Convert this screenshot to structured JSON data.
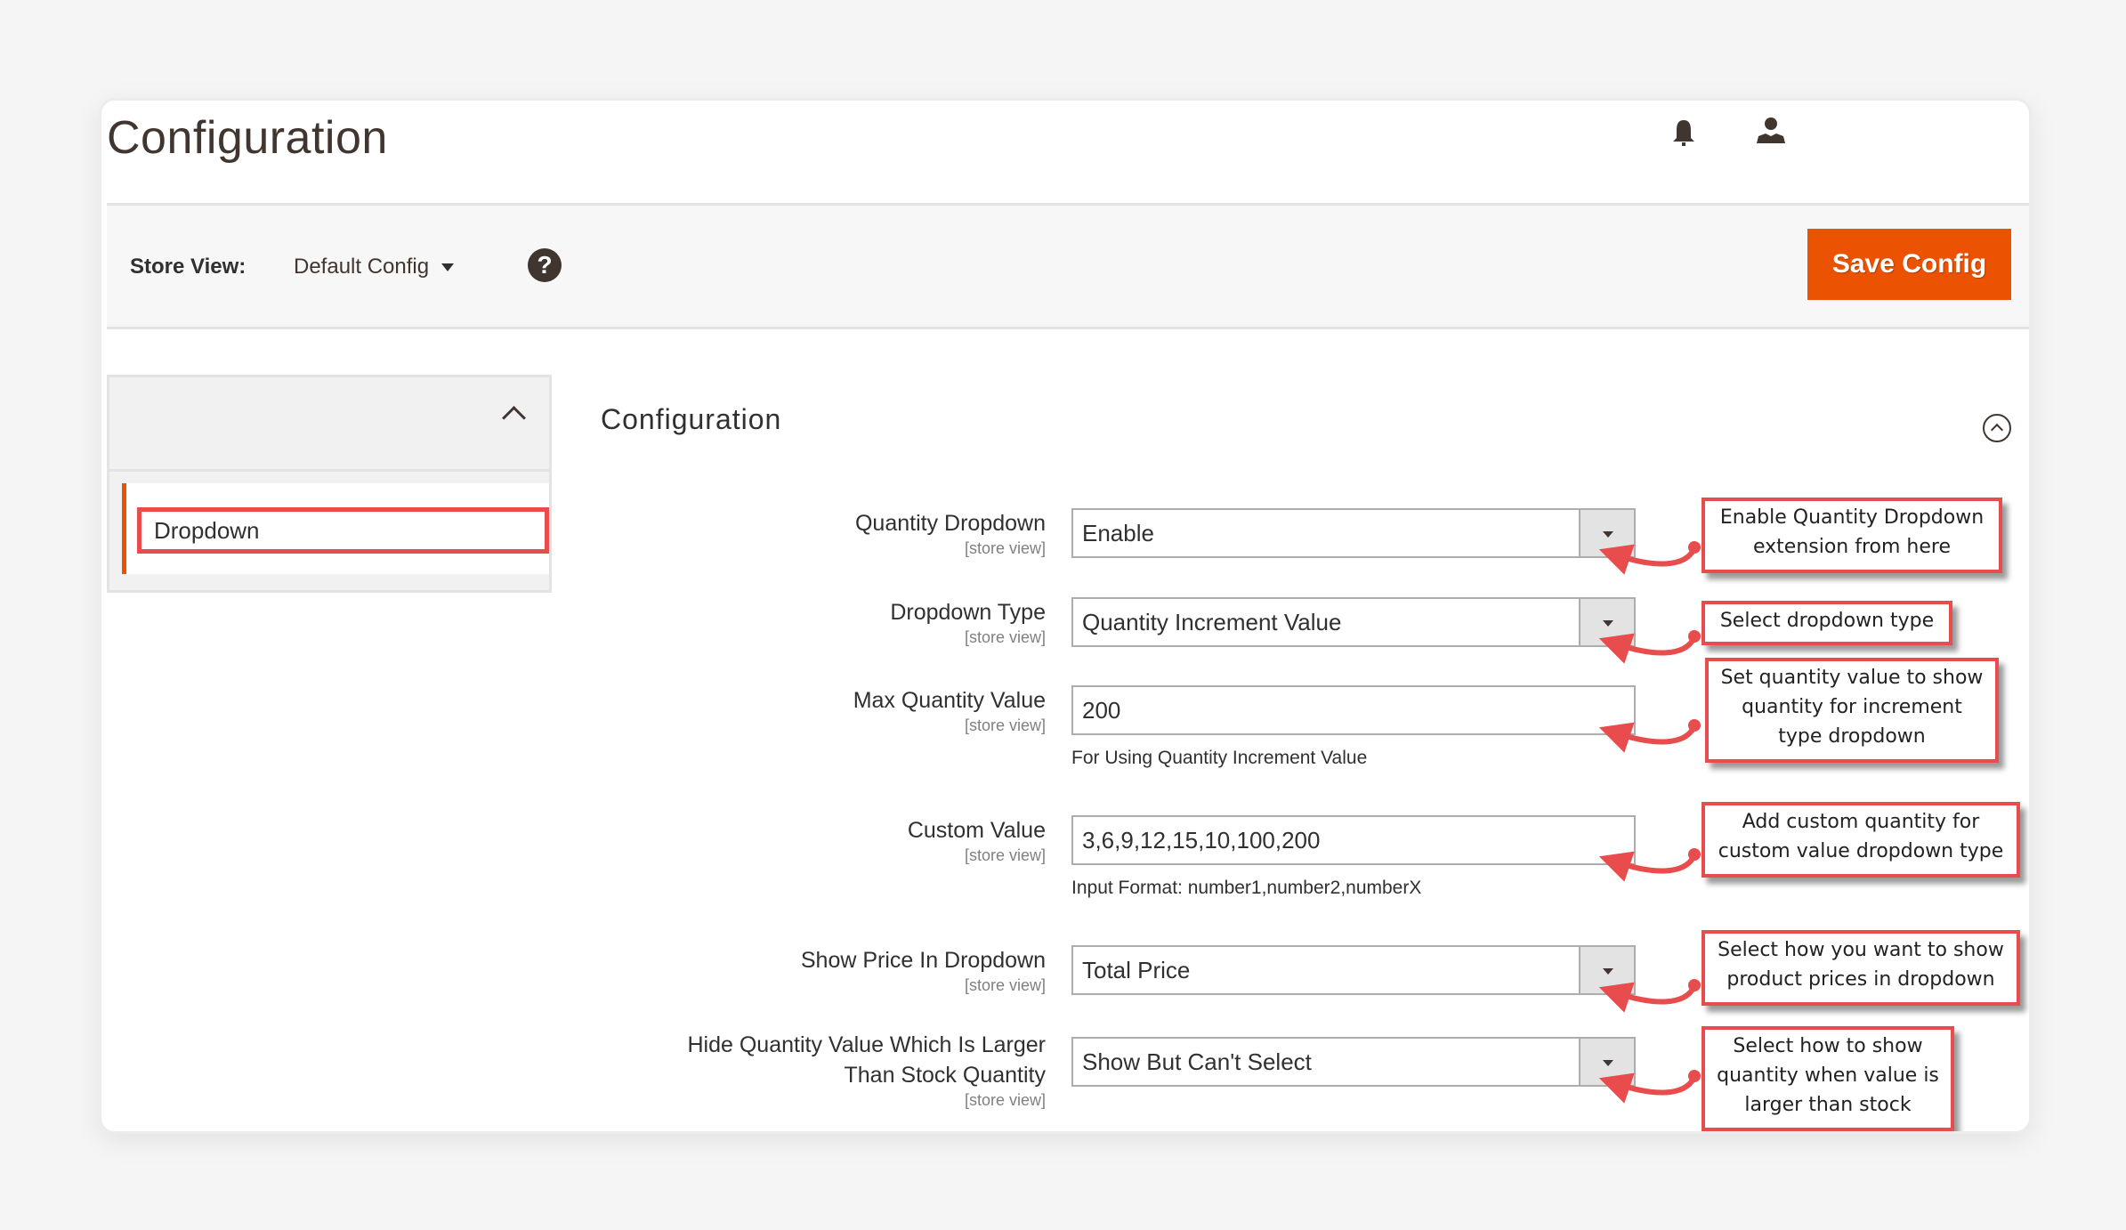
{
  "page": {
    "title": "Configuration",
    "header_icons": [
      "bell-icon",
      "user-icon"
    ]
  },
  "store_bar": {
    "label": "Store View:",
    "value": "Default Config",
    "help_symbol": "?",
    "save_label": "Save Config"
  },
  "sidebar": {
    "items": [
      {
        "label": "Dropdown",
        "active": true
      }
    ]
  },
  "section": {
    "title": "Configuration",
    "fields": [
      {
        "label": "Quantity Dropdown",
        "scope": "[store view]",
        "type": "select",
        "value": "Enable",
        "note": ""
      },
      {
        "label": "Dropdown Type",
        "scope": "[store view]",
        "type": "select",
        "value": "Quantity Increment Value",
        "note": ""
      },
      {
        "label": "Max Quantity Value",
        "scope": "[store view]",
        "type": "text",
        "value": "200",
        "note": "For Using Quantity Increment Value"
      },
      {
        "label": "Custom Value",
        "scope": "[store view]",
        "type": "text",
        "value": "3,6,9,12,15,10,100,200",
        "note": "Input Format: number1,number2,numberX"
      },
      {
        "label": "Show Price In Dropdown",
        "scope": "[store view]",
        "type": "select",
        "value": "Total Price",
        "note": ""
      },
      {
        "label_line1": "Hide Quantity Value Which Is Larger",
        "label_line2": "Than Stock Quantity",
        "scope": "[store view]",
        "type": "select",
        "value": "Show But Can't Select",
        "note": ""
      }
    ]
  },
  "callouts": [
    {
      "line1": "Enable Quantity Dropdown",
      "line2": "extension from here"
    },
    {
      "line1": "Select dropdown type"
    },
    {
      "line1": "Set quantity value to show",
      "line2": "quantity for increment",
      "line3": "type dropdown"
    },
    {
      "line1": "Add custom quantity for",
      "line2": "custom value dropdown type"
    },
    {
      "line1": "Select how you want to show",
      "line2": "product prices in dropdown"
    },
    {
      "line1": "Select how to show",
      "line2": "quantity when value is",
      "line3": "larger than stock"
    }
  ],
  "colors": {
    "accent": "#eb5202",
    "annotation": "#e84c4c",
    "text": "#303030"
  }
}
